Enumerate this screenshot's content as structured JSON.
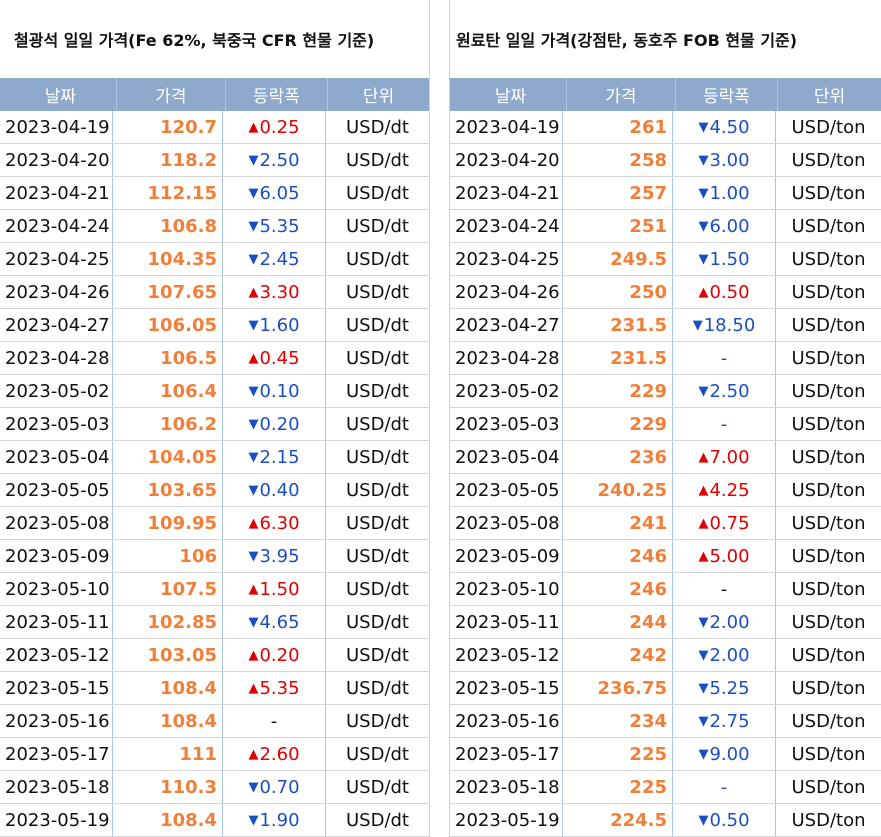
{
  "left": {
    "title": "철광석 일일 가격(Fe 62%, 북중국 CFR 현물 기준)",
    "headers": [
      "날짜",
      "가격",
      "등락폭",
      "단위"
    ],
    "rows": [
      {
        "date": "2023-04-19",
        "price": "120.7",
        "dir": "up",
        "change": "0.25",
        "unit": "USD/dt"
      },
      {
        "date": "2023-04-20",
        "price": "118.2",
        "dir": "down",
        "change": "2.50",
        "unit": "USD/dt"
      },
      {
        "date": "2023-04-21",
        "price": "112.15",
        "dir": "down",
        "change": "6.05",
        "unit": "USD/dt"
      },
      {
        "date": "2023-04-24",
        "price": "106.8",
        "dir": "down",
        "change": "5.35",
        "unit": "USD/dt"
      },
      {
        "date": "2023-04-25",
        "price": "104.35",
        "dir": "down",
        "change": "2.45",
        "unit": "USD/dt"
      },
      {
        "date": "2023-04-26",
        "price": "107.65",
        "dir": "up",
        "change": "3.30",
        "unit": "USD/dt"
      },
      {
        "date": "2023-04-27",
        "price": "106.05",
        "dir": "down",
        "change": "1.60",
        "unit": "USD/dt"
      },
      {
        "date": "2023-04-28",
        "price": "106.5",
        "dir": "up",
        "change": "0.45",
        "unit": "USD/dt"
      },
      {
        "date": "2023-05-02",
        "price": "106.4",
        "dir": "down",
        "change": "0.10",
        "unit": "USD/dt"
      },
      {
        "date": "2023-05-03",
        "price": "106.2",
        "dir": "down",
        "change": "0.20",
        "unit": "USD/dt"
      },
      {
        "date": "2023-05-04",
        "price": "104.05",
        "dir": "down",
        "change": "2.15",
        "unit": "USD/dt"
      },
      {
        "date": "2023-05-05",
        "price": "103.65",
        "dir": "down",
        "change": "0.40",
        "unit": "USD/dt"
      },
      {
        "date": "2023-05-08",
        "price": "109.95",
        "dir": "up",
        "change": "6.30",
        "unit": "USD/dt"
      },
      {
        "date": "2023-05-09",
        "price": "106",
        "dir": "down",
        "change": "3.95",
        "unit": "USD/dt"
      },
      {
        "date": "2023-05-10",
        "price": "107.5",
        "dir": "up",
        "change": "1.50",
        "unit": "USD/dt"
      },
      {
        "date": "2023-05-11",
        "price": "102.85",
        "dir": "down",
        "change": "4.65",
        "unit": "USD/dt"
      },
      {
        "date": "2023-05-12",
        "price": "103.05",
        "dir": "up",
        "change": "0.20",
        "unit": "USD/dt"
      },
      {
        "date": "2023-05-15",
        "price": "108.4",
        "dir": "up",
        "change": "5.35",
        "unit": "USD/dt"
      },
      {
        "date": "2023-05-16",
        "price": "108.4",
        "dir": "flat",
        "change": "-",
        "unit": "USD/dt"
      },
      {
        "date": "2023-05-17",
        "price": "111",
        "dir": "up",
        "change": "2.60",
        "unit": "USD/dt"
      },
      {
        "date": "2023-05-18",
        "price": "110.3",
        "dir": "down",
        "change": "0.70",
        "unit": "USD/dt"
      },
      {
        "date": "2023-05-19",
        "price": "108.4",
        "dir": "down",
        "change": "1.90",
        "unit": "USD/dt"
      }
    ]
  },
  "right": {
    "title": "원료탄 일일 가격(강점탄, 동호주 FOB 현물 기준)",
    "headers": [
      "날짜",
      "가격",
      "등락폭",
      "단위"
    ],
    "rows": [
      {
        "date": "2023-04-19",
        "price": "261",
        "dir": "down",
        "change": "4.50",
        "unit": "USD/ton"
      },
      {
        "date": "2023-04-20",
        "price": "258",
        "dir": "down",
        "change": "3.00",
        "unit": "USD/ton"
      },
      {
        "date": "2023-04-21",
        "price": "257",
        "dir": "down",
        "change": "1.00",
        "unit": "USD/ton"
      },
      {
        "date": "2023-04-24",
        "price": "251",
        "dir": "down",
        "change": "6.00",
        "unit": "USD/ton"
      },
      {
        "date": "2023-04-25",
        "price": "249.5",
        "dir": "down",
        "change": "1.50",
        "unit": "USD/ton"
      },
      {
        "date": "2023-04-26",
        "price": "250",
        "dir": "up",
        "change": "0.50",
        "unit": "USD/ton"
      },
      {
        "date": "2023-04-27",
        "price": "231.5",
        "dir": "down",
        "change": "18.50",
        "unit": "USD/ton"
      },
      {
        "date": "2023-04-28",
        "price": "231.5",
        "dir": "none",
        "change": "-",
        "unit": "USD/ton"
      },
      {
        "date": "2023-05-02",
        "price": "229",
        "dir": "down",
        "change": "2.50",
        "unit": "USD/ton"
      },
      {
        "date": "2023-05-03",
        "price": "229",
        "dir": "none",
        "change": "-",
        "unit": "USD/ton"
      },
      {
        "date": "2023-05-04",
        "price": "236",
        "dir": "up",
        "change": "7.00",
        "unit": "USD/ton"
      },
      {
        "date": "2023-05-05",
        "price": "240.25",
        "dir": "up",
        "change": "4.25",
        "unit": "USD/ton"
      },
      {
        "date": "2023-05-08",
        "price": "241",
        "dir": "up",
        "change": "0.75",
        "unit": "USD/ton"
      },
      {
        "date": "2023-05-09",
        "price": "246",
        "dir": "up",
        "change": "5.00",
        "unit": "USD/ton"
      },
      {
        "date": "2023-05-10",
        "price": "246",
        "dir": "flat",
        "change": "-",
        "unit": "USD/ton"
      },
      {
        "date": "2023-05-11",
        "price": "244",
        "dir": "down",
        "change": "2.00",
        "unit": "USD/ton"
      },
      {
        "date": "2023-05-12",
        "price": "242",
        "dir": "down",
        "change": "2.00",
        "unit": "USD/ton"
      },
      {
        "date": "2023-05-15",
        "price": "236.75",
        "dir": "down",
        "change": "5.25",
        "unit": "USD/ton"
      },
      {
        "date": "2023-05-16",
        "price": "234",
        "dir": "down",
        "change": "2.75",
        "unit": "USD/ton"
      },
      {
        "date": "2023-05-17",
        "price": "225",
        "dir": "down",
        "change": "9.00",
        "unit": "USD/ton"
      },
      {
        "date": "2023-05-18",
        "price": "225",
        "dir": "none",
        "change": "-",
        "unit": "USD/ton"
      },
      {
        "date": "2023-05-19",
        "price": "224.5",
        "dir": "down",
        "change": "0.50",
        "unit": "USD/ton"
      }
    ]
  },
  "colors": {
    "header_bg": "#8ea9cc",
    "price": "#f07f3a",
    "up": "#e00000",
    "down": "#1a4fc4"
  },
  "icons": {
    "up": "triangle-up-icon",
    "down": "triangle-down-icon"
  }
}
